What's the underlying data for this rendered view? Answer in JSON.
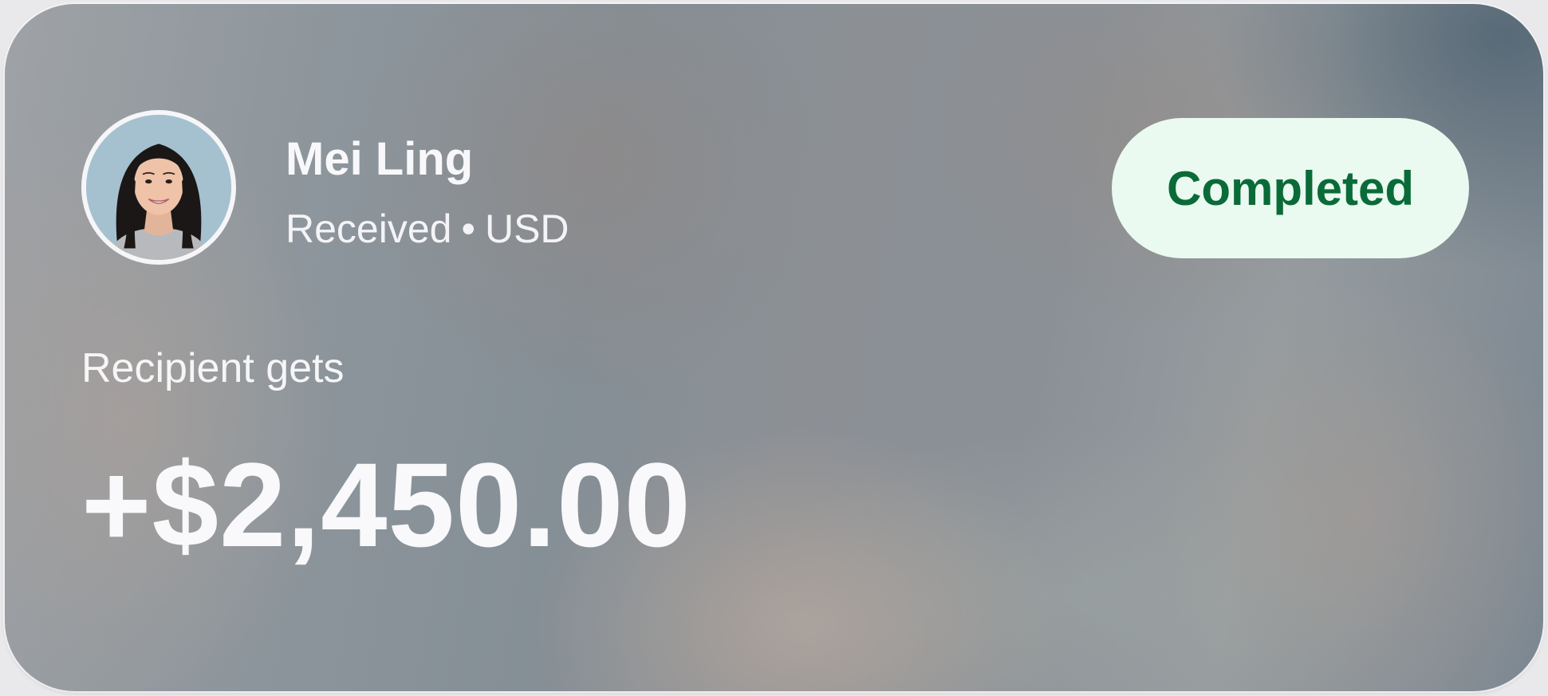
{
  "transaction": {
    "contact_name": "Mei Ling",
    "direction": "Received",
    "separator": "•",
    "currency": "USD",
    "status": "Completed",
    "amount_label": "Recipient gets",
    "amount": "+$2,450.00"
  },
  "colors": {
    "status_bg": "#eafaf1",
    "status_text": "#0b6b38",
    "text_primary": "#f8f8fa"
  },
  "icons": {
    "avatar": "contact-avatar-photo"
  }
}
